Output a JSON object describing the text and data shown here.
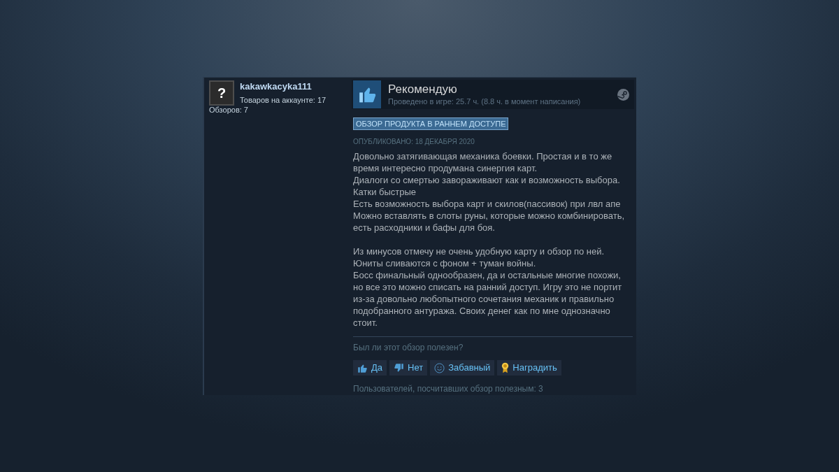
{
  "reviewer": {
    "avatar_glyph": "?",
    "username": "kakawkacyka111",
    "products_owned": "Товаров на аккаунте: 17",
    "review_count": "Обзоров: 7"
  },
  "review": {
    "recommended": true,
    "verdict": "Рекомендую",
    "playtime": "Проведено в игре: 25.7 ч. (8.8 ч. в момент написания)",
    "badge": "ОБЗОР ПРОДУКТА В РАННЕМ ДОСТУПЕ",
    "posted": "ОПУБЛИКОВАНО: 18 ДЕКАБРЯ 2020",
    "paragraphs": [
      "Довольно затягивающая механика боевки. Простая и в то же время интересно продумана синергия карт.\nДиалоги со смертью завораживают как и возможность выбора.\nКатки быстрые\nЕсть возможность выбора карт и скилов(пассивок) при лвл апе\nМожно вставлять в слоты руны, которые можно комбинировать, есть расходники и бафы для боя.",
      "Из минусов отмечу не очень удобную карту и обзор по ней.\nЮниты сливаются с фоном + туман войны.\nБосс финальный однообразен, да и остальные многие похожи, но все это можно списать на ранний доступ. Игру это не портит из-за довольно любопытного сочетания механик и правильно подобранного антуража. Своих денег как по мне однозначно стоит."
    ]
  },
  "feedback": {
    "question": "Был ли этот обзор полезен?",
    "buttons": [
      {
        "kind": "yes",
        "label": "Да"
      },
      {
        "kind": "no",
        "label": "Нет"
      },
      {
        "kind": "funny",
        "label": "Забавный"
      },
      {
        "kind": "award",
        "label": "Наградить"
      }
    ],
    "helpful_count": "Пользователей, посчитавших обзор полезным: 3"
  }
}
